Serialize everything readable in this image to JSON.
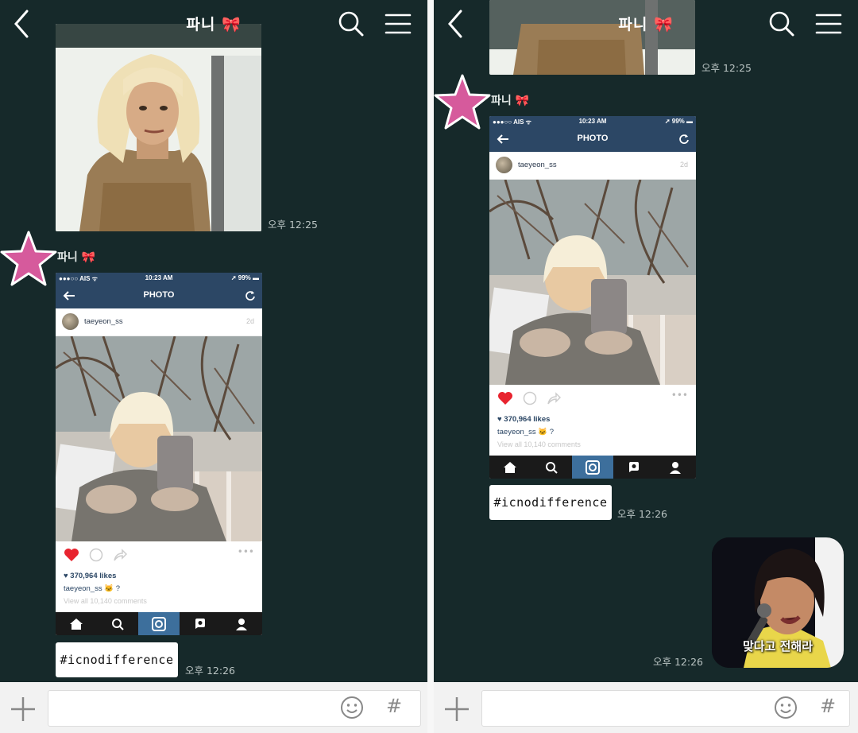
{
  "chat": {
    "title": "파니 🎀",
    "sender_name": "파니 🎀",
    "hashtag_message": "#icnodifference",
    "photo_time": "오후 12:25",
    "hashtag_time": "오후 12:26",
    "gif_time": "오후 12:26",
    "gif_caption": "맞다고 전해라"
  },
  "instagram": {
    "carrier": "●●●○○ AIS ᯤ",
    "clock": "10:23 AM",
    "battery": "➚ 99% ▬",
    "nav_title": "PHOTO",
    "username": "taeyeon_ss",
    "age": "2d",
    "likes": "♥ 370,964 likes",
    "caption": "taeyeon_ss 🐱 ?",
    "comments": "View all 10,140 comments"
  },
  "colors": {
    "chat_background": "#16292a",
    "ig_nav": "#2c4765",
    "ig_tab_active": "#3d6f9c",
    "star": "#d65a9c",
    "heart": "#e8242f"
  },
  "icons": [
    "back-icon",
    "search-icon",
    "menu-icon",
    "plus-icon",
    "emoji-icon",
    "hash-icon",
    "star-icon",
    "heart-icon",
    "comment-icon",
    "share-icon",
    "home-icon",
    "camera-icon",
    "profile-icon"
  ]
}
